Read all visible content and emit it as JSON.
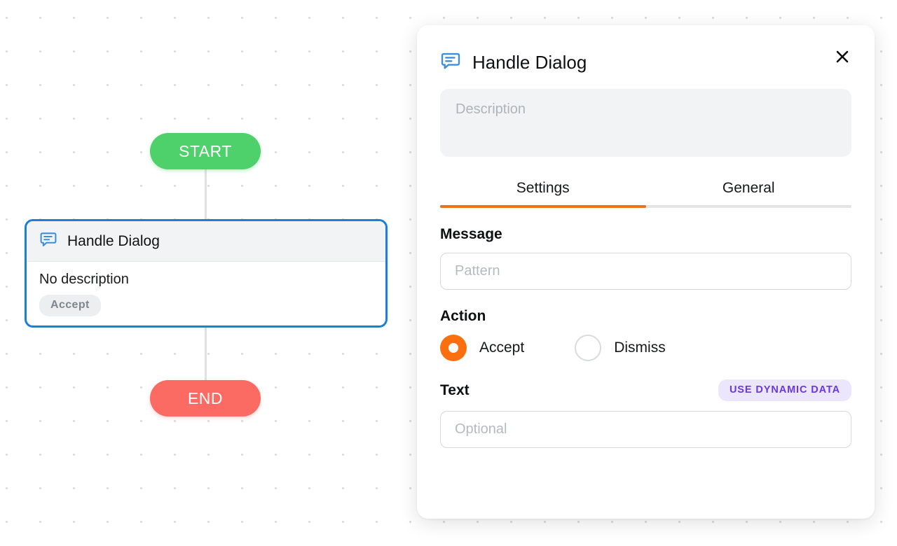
{
  "canvas": {
    "start_node": {
      "label": "START",
      "color": "#4ed06a"
    },
    "end_node": {
      "label": "END",
      "color": "#fb6a63"
    },
    "action_node": {
      "icon": "message-bubble-icon",
      "title": "Handle Dialog",
      "description": "No description",
      "chip": "Accept",
      "border_color": "#1c7ed6"
    }
  },
  "panel": {
    "icon": "message-bubble-icon",
    "title": "Handle Dialog",
    "close_label": "✕",
    "description": {
      "value": "",
      "placeholder": "Description"
    },
    "tabs": [
      {
        "label": "Settings",
        "active": true
      },
      {
        "label": "General",
        "active": false
      }
    ],
    "active_tab_color": "#ea7317",
    "fields": {
      "message": {
        "label": "Message",
        "value": "",
        "placeholder": "Pattern"
      },
      "action": {
        "label": "Action",
        "selected": "Accept",
        "options": [
          {
            "label": "Accept",
            "checked": true
          },
          {
            "label": "Dismiss",
            "checked": false
          }
        ]
      },
      "text": {
        "label": "Text",
        "value": "",
        "placeholder": "Optional",
        "badge": "USE DYNAMIC DATA",
        "badge_color": "#6b37e0"
      }
    }
  }
}
